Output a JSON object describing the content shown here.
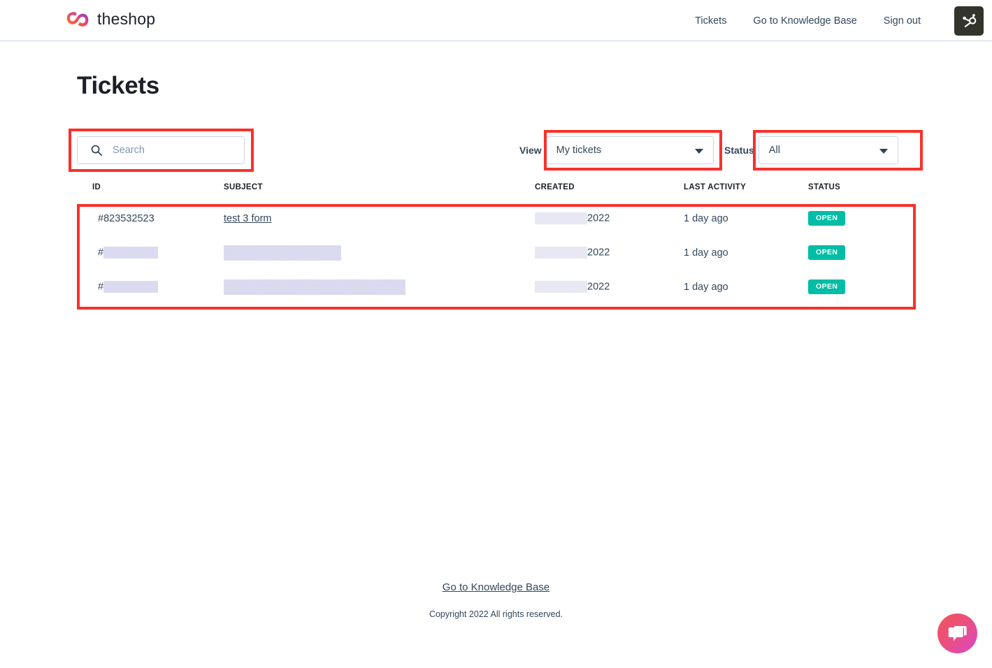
{
  "header": {
    "brand_name": "theshop",
    "logo_icon": "infinity-logo-icon",
    "nav": [
      {
        "label": "Tickets",
        "name": "nav-tickets"
      },
      {
        "label": "Go to Knowledge Base",
        "name": "nav-knowledge-base"
      },
      {
        "label": "Sign out",
        "name": "nav-sign-out"
      }
    ],
    "badge_icon": "hubspot-sprocket-icon"
  },
  "page": {
    "title": "Tickets"
  },
  "filters": {
    "search": {
      "icon": "search-icon",
      "value": "",
      "placeholder": "Search"
    },
    "view": {
      "label": "View",
      "selected": "My tickets",
      "caret_icon": "chevron-down-icon"
    },
    "status": {
      "label": "Status",
      "selected": "All",
      "caret_icon": "chevron-down-icon"
    }
  },
  "table": {
    "columns": [
      "ID",
      "SUBJECT",
      "CREATED",
      "LAST ACTIVITY",
      "STATUS"
    ],
    "rows": [
      {
        "id": "#823532523",
        "id_redacted": false,
        "subject": "test 3 form",
        "subject_redacted": false,
        "created": "2022",
        "created_redacted": true,
        "last_activity": "1 day ago",
        "status": "OPEN"
      },
      {
        "id": "#",
        "id_redacted": true,
        "subject": "",
        "subject_redacted": true,
        "created": "2022",
        "created_redacted": true,
        "last_activity": "1 day ago",
        "status": "OPEN"
      },
      {
        "id": "#",
        "id_redacted": true,
        "subject": "",
        "subject_redacted": true,
        "created": "2022",
        "created_redacted": true,
        "last_activity": "1 day ago",
        "status": "OPEN"
      }
    ]
  },
  "footer": {
    "link": "Go to Knowledge Base",
    "copyright": "Copyright 2022 All rights reserved."
  },
  "chat": {
    "icon": "chat-bubble-icon"
  },
  "colors": {
    "annotation": "#f8312b",
    "status_badge": "#00bda5",
    "text": "#33475b",
    "border": "#cbd6e2",
    "chat_accent": "#ec4f7c"
  }
}
